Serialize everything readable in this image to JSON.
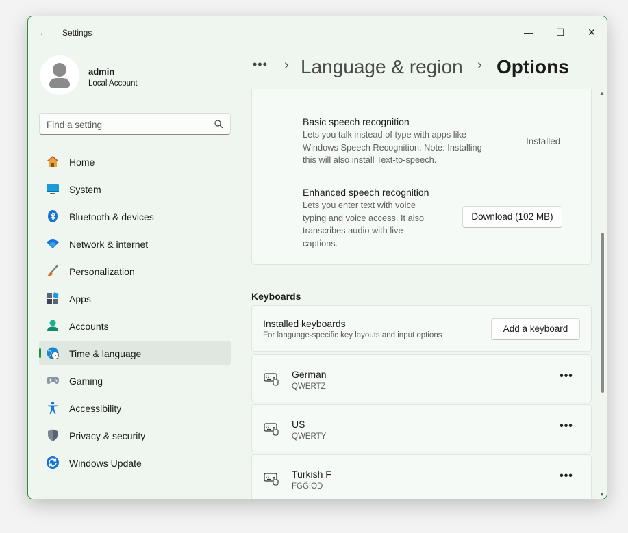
{
  "window": {
    "title": "Settings",
    "back_glyph": "←",
    "minimize_glyph": "—",
    "maximize_glyph": "☐",
    "close_glyph": "✕"
  },
  "profile": {
    "name": "admin",
    "account_type": "Local Account"
  },
  "search": {
    "placeholder": "Find a setting"
  },
  "sidebar": {
    "items": [
      {
        "label": "Home",
        "icon": "home-icon"
      },
      {
        "label": "System",
        "icon": "system-icon"
      },
      {
        "label": "Bluetooth & devices",
        "icon": "bluetooth-icon"
      },
      {
        "label": "Network & internet",
        "icon": "wifi-icon"
      },
      {
        "label": "Personalization",
        "icon": "brush-icon"
      },
      {
        "label": "Apps",
        "icon": "apps-icon"
      },
      {
        "label": "Accounts",
        "icon": "accounts-icon"
      },
      {
        "label": "Time & language",
        "icon": "time-language-icon",
        "active": true
      },
      {
        "label": "Gaming",
        "icon": "gaming-icon"
      },
      {
        "label": "Accessibility",
        "icon": "accessibility-icon"
      },
      {
        "label": "Privacy & security",
        "icon": "shield-icon"
      },
      {
        "label": "Windows Update",
        "icon": "update-icon"
      }
    ]
  },
  "breadcrumb": {
    "more": "•••",
    "separator": "›",
    "parent": "Language & region",
    "current": "Options"
  },
  "speech": {
    "basic": {
      "title": "Basic speech recognition",
      "desc_lines": [
        "Lets you talk instead of type with apps like",
        "Windows Speech Recognition. Note: Installing",
        "this will also install Text-to-speech."
      ],
      "status": "Installed"
    },
    "enhanced": {
      "title": "Enhanced speech recognition",
      "desc_lines": [
        "Lets you enter text with voice",
        "typing and voice access. It also",
        "transcribes audio with live",
        "captions."
      ],
      "button": "Download (102 MB)"
    }
  },
  "keyboards": {
    "section_title": "Keyboards",
    "header_title": "Installed keyboards",
    "header_sub": "For language-specific key layouts and input options",
    "add_button": "Add a keyboard",
    "more_glyph": "•••",
    "items": [
      {
        "name": "German",
        "layout": "QWERTZ"
      },
      {
        "name": "US",
        "layout": "QWERTY"
      },
      {
        "name": "Turkish F",
        "layout": "FGĞIOD"
      }
    ]
  },
  "scrollbar": {
    "up_glyph": "▲",
    "down_glyph": "▼"
  },
  "colors": {
    "accent": "#1f8f3a",
    "window_border": "#2f8a3a"
  }
}
